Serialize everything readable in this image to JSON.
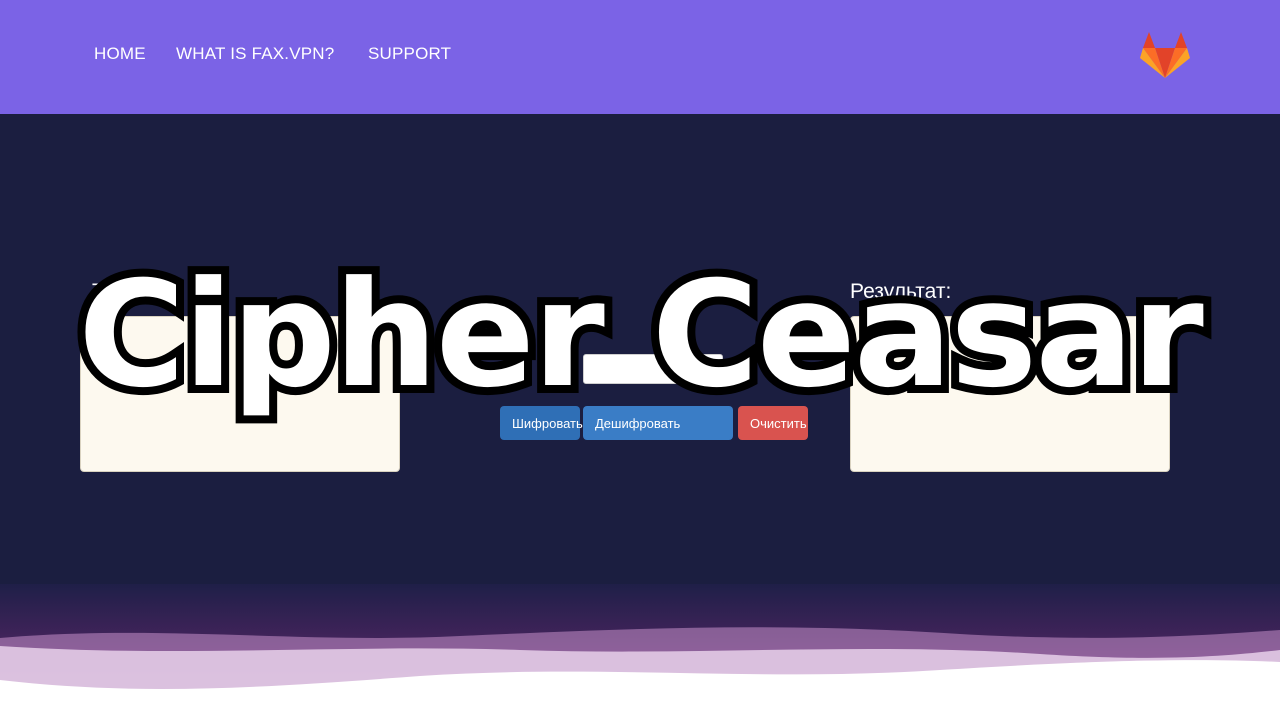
{
  "nav": {
    "home": "HOME",
    "what": "WHAT IS FAX.VPN?",
    "support": "SUPPORT"
  },
  "logo": {
    "icon": "gitlab-fox-icon"
  },
  "form": {
    "input_label": "Текст:",
    "result_label": "Результат:",
    "input_text": "",
    "result_text": "",
    "shift_value": "",
    "encrypt_button": "Шифровать",
    "decrypt_button": "Дешифровать",
    "clear_button": "Очистить"
  },
  "overlay_title": "Cipher Ceasar",
  "colors": {
    "navbar": "#7b63e6",
    "background": "#1b1e40",
    "textbox": "#fdf9ef",
    "primary_button": "#2f6fb6",
    "danger_button": "#d9534f"
  }
}
